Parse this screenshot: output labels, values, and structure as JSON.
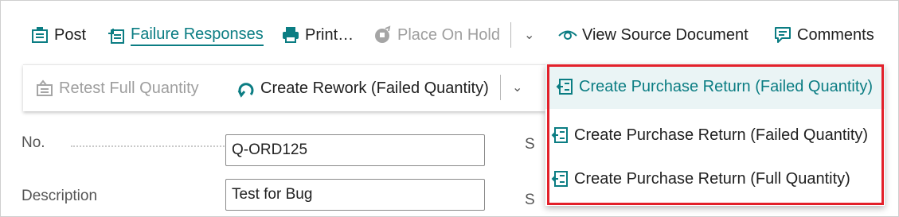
{
  "actions_bar": {
    "post": "Post",
    "failure_responses": "Failure Responses",
    "print": "Print…",
    "place_on_hold": "Place On Hold",
    "view_source_document": "View Source Document",
    "comments": "Comments"
  },
  "secondary_bar": {
    "retest_full_quantity": "Retest Full Quantity",
    "create_rework": "Create Rework (Failed Quantity)",
    "create_purchase_return_failed": "Create Purchase Return (Failed Quantity)"
  },
  "dropdown": {
    "items": [
      "Create Purchase Return (Failed Quantity)",
      "Create Purchase Return (Full Quantity)"
    ]
  },
  "form": {
    "no_label": "No.",
    "no_value": "Q-ORD125",
    "description_label": "Description",
    "description_value": "Test for Bug",
    "cut_label_1": "S",
    "cut_label_2": "S"
  },
  "colors": {
    "accent": "#0b7d83",
    "highlight_border": "#e3202a"
  }
}
